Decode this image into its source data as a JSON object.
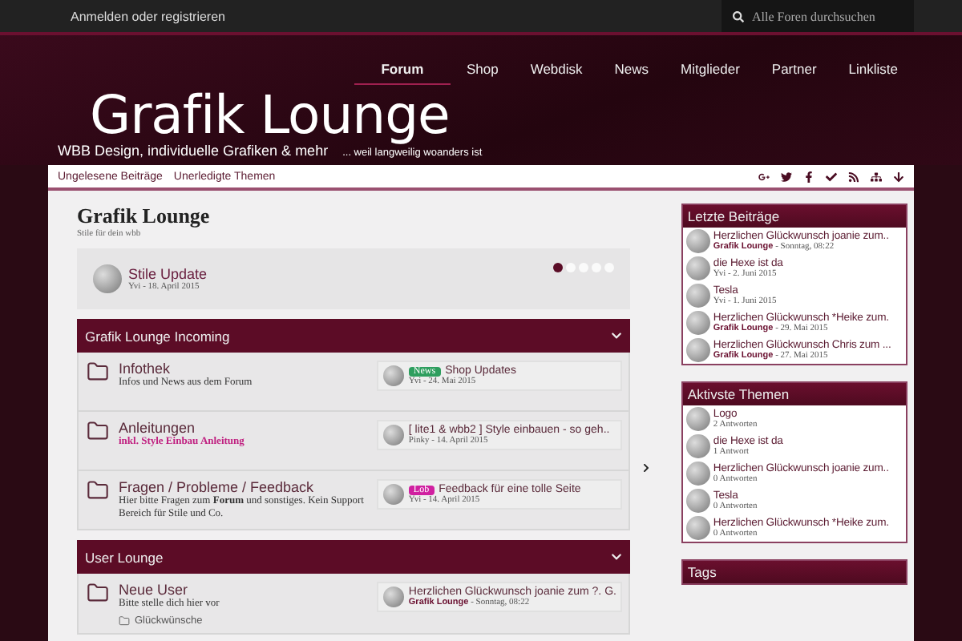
{
  "top_bar": {
    "login_link": "Anmelden oder registrieren",
    "search": {
      "placeholder": "Alle Foren durchsuchen"
    }
  },
  "nav": [
    {
      "label": "Forum",
      "selected": true
    },
    {
      "label": "Shop",
      "selected": false
    },
    {
      "label": "Webdisk",
      "selected": false
    },
    {
      "label": "News",
      "selected": false
    },
    {
      "label": "Mitglieder",
      "selected": false
    },
    {
      "label": "Partner",
      "selected": false
    },
    {
      "label": "Linkliste",
      "selected": false
    }
  ],
  "logo": {
    "title": "Grafik Lounge",
    "tagline": "WBB Design, individuelle Grafiken & mehr",
    "slogan": "... weil langweilig woanders ist"
  },
  "subnav": {
    "links": [
      "Ungelesene Beiträge",
      "Unerledigte Themen"
    ]
  },
  "page": {
    "title": "Grafik Lounge",
    "subtitle": "Stile für dein wbb"
  },
  "slider": {
    "title": "Stile Update",
    "meta": "Yvi - 18. April 2015",
    "dots": [
      {
        "selected": true
      },
      {
        "selected": false
      },
      {
        "selected": false
      },
      {
        "selected": false
      },
      {
        "selected": false
      }
    ]
  },
  "categories": [
    {
      "title": "Grafik Lounge Incoming",
      "expanded": true,
      "boards": [
        {
          "title": "Infothek",
          "description": "Infos und News aus dem Forum",
          "highlight": false,
          "last_post": {
            "badge": {
              "label": "News",
              "color": "#2e9e5e"
            },
            "title": "Shop Updates",
            "meta": "Yvi - 24. Mai 2015"
          }
        },
        {
          "title": "Anleitungen",
          "description": "inkl. Style Einbau Anleitung",
          "highlight": true,
          "last_post": {
            "title": "[ lite1 & wbb2 ] Style einbauen - so geh..",
            "meta": "Pinky - 14. April 2015"
          }
        },
        {
          "title": "Fragen / Probleme / Feedback",
          "description": "Hier bitte Fragen zum **Forum** und sonstiges. Kein Support Bereich für Stile und Co.",
          "highlight": false,
          "last_post": {
            "badge": {
              "label": "Lob",
              "color": "#d020a0"
            },
            "title": "Feedback für eine tolle Seite",
            "meta": "Yvi - 14. April 2015"
          }
        }
      ]
    },
    {
      "title": "User Lounge",
      "expanded": true,
      "boards": [
        {
          "title": "Neue User",
          "description": "Bitte stelle dich hier vor",
          "highlight": false,
          "subforums": [
            "Glückwünsche"
          ],
          "last_post": {
            "title": "Herzlichen Glückwunsch joanie zum ?. G.",
            "meta": "**Grafik Lounge** - Sonntag, 08:22"
          }
        }
      ]
    }
  ],
  "sidebar": [
    {
      "title": "Letzte Beiträge",
      "items": [
        {
          "title": "Herzlichen Glückwunsch joanie zum..",
          "meta": "**Grafik Lounge** - Sonntag, 08:22"
        },
        {
          "title": "die Hexe ist da",
          "meta": "Yvi - 2. Juni 2015"
        },
        {
          "title": "Tesla",
          "meta": "Yvi - 1. Juni 2015"
        },
        {
          "title": "Herzlichen Glückwunsch *Heike zum.",
          "meta": "**Grafik Lounge** - 29. Mai 2015"
        },
        {
          "title": "Herzlichen Glückwunsch Chris zum ...",
          "meta": "**Grafik Lounge** - 27. Mai 2015"
        }
      ]
    },
    {
      "title": "Aktivste Themen",
      "items": [
        {
          "title": "Logo",
          "meta": "2 Antworten"
        },
        {
          "title": "die Hexe ist da",
          "meta": "1 Antwort"
        },
        {
          "title": "Herzlichen Glückwunsch joanie zum..",
          "meta": "0 Antworten"
        },
        {
          "title": "Tesla",
          "meta": "0 Antworten"
        },
        {
          "title": "Herzlichen Glückwunsch *Heike zum.",
          "meta": "0 Antworten"
        }
      ]
    },
    {
      "title": "Tags"
    }
  ]
}
